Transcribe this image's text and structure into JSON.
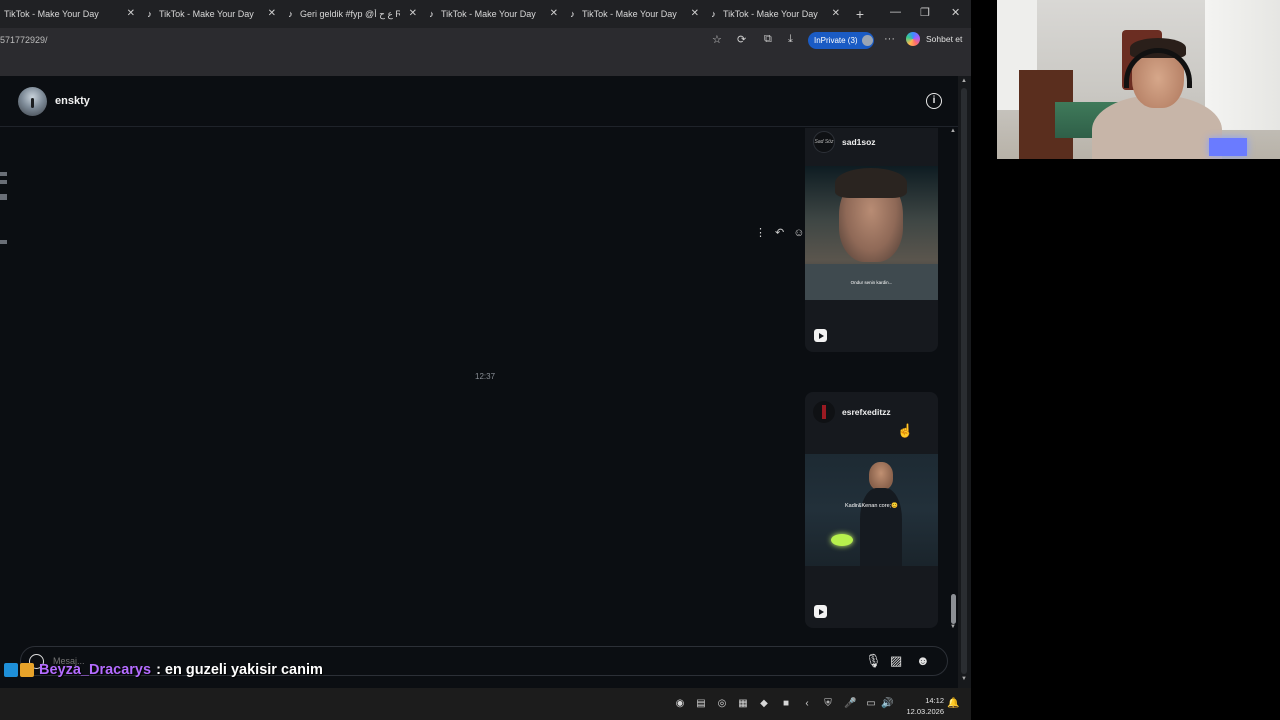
{
  "browser": {
    "tabs": [
      {
        "label": "TikTok - Make Your Day"
      },
      {
        "label": "TikTok - Make Your Day"
      },
      {
        "label": "Geri geldik #fyp @ﻉ ﺡ ﺃ RACON"
      },
      {
        "label": "TikTok - Make Your Day"
      },
      {
        "label": "TikTok - Make Your Day"
      },
      {
        "label": "TikTok - Make Your Day"
      }
    ],
    "url": "571772929/",
    "inprivate_label": "InPrivate (3)",
    "copilot_label": "Sohbet et"
  },
  "chat": {
    "username": "enskty",
    "time_separator": "12:37",
    "posts": [
      {
        "author": "sad1soz",
        "avatar_text": "Sad Söz",
        "video_subtitle": "Ondur senin kardin..."
      },
      {
        "author": "esrefxeditzz",
        "video_caption": "Kadir&Kenan core;😊"
      }
    ],
    "composer_placeholder": "Mesaj..."
  },
  "stream_chat": {
    "user": "Beyza_Dracarys",
    "message": ": en guzeli yakisir canim"
  },
  "taskbar": {
    "time": "14:12",
    "date": "12.03.2026"
  },
  "colors": {
    "accent_inprivate": "#1a5bc4",
    "chat_username": "#b46cff",
    "background": "#0b0e12"
  }
}
